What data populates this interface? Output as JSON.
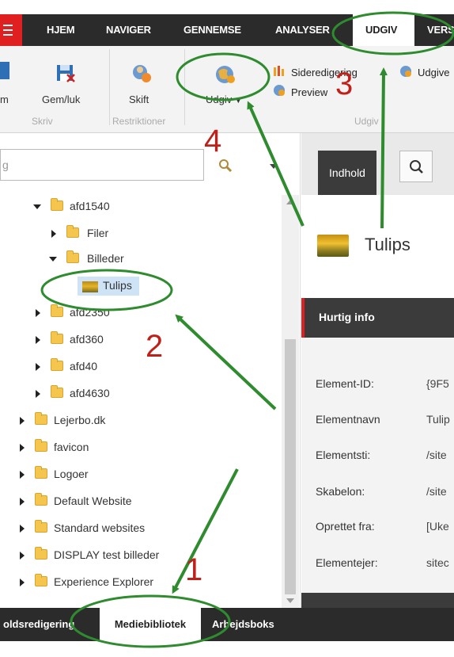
{
  "top_nav": {
    "tabs": [
      {
        "label": "HJEM"
      },
      {
        "label": "NAVIGER"
      },
      {
        "label": "GENNEMSE"
      },
      {
        "label": "ANALYSER"
      },
      {
        "label": "UDGIV"
      },
      {
        "label": "VERS"
      }
    ],
    "active_tab": "UDGIV"
  },
  "ribbon": {
    "buttons": {
      "save_partial": "m",
      "save_close": "Gem/luk",
      "shift": "Skift",
      "publish": "Udgiv",
      "page_edit": "Sideredigering",
      "preview": "Preview",
      "publish_partial": "Udgive"
    },
    "groups": {
      "write": "Skriv",
      "restrictions": "Restriktioner",
      "publish_group": "Udgiv"
    }
  },
  "search": {
    "value": "g"
  },
  "tree": [
    {
      "label": "afd1540",
      "expanded": true
    },
    {
      "label": "Filer",
      "expanded": false
    },
    {
      "label": "Billeder",
      "expanded": true
    },
    {
      "label": "Tulips",
      "selected": true
    },
    {
      "label": "afd2350",
      "expanded": false
    },
    {
      "label": "afd360",
      "expanded": false
    },
    {
      "label": "afd40",
      "expanded": false
    },
    {
      "label": "afd4630",
      "expanded": false
    },
    {
      "label": "Lejerbo.dk",
      "expanded": false
    },
    {
      "label": "favicon",
      "expanded": false
    },
    {
      "label": "Logoer",
      "expanded": false
    },
    {
      "label": "Default Website",
      "expanded": false
    },
    {
      "label": "Standard websites",
      "expanded": false
    },
    {
      "label": "DISPLAY test billeder",
      "expanded": false
    },
    {
      "label": "Experience Explorer",
      "expanded": false
    }
  ],
  "bottom_tabs": [
    {
      "label": "oldsredigering"
    },
    {
      "label": "Mediebibliotek"
    },
    {
      "label": "Arbejdsboks"
    }
  ],
  "right_panel": {
    "tab_content": "Indhold",
    "item_title": "Tulips",
    "quick_info_header": "Hurtig info",
    "quick_info": [
      {
        "label": "Element-ID:",
        "value": "{9F5"
      },
      {
        "label": "Elementnavn",
        "value": "Tulip"
      },
      {
        "label": "Elementsti:",
        "value": "/site"
      },
      {
        "label": "Skabelon:",
        "value": "/site"
      },
      {
        "label": "Oprettet fra:",
        "value": "[Uke"
      },
      {
        "label": "Elementejer:",
        "value": "sitec"
      }
    ]
  },
  "annotations": {
    "step1": "1",
    "step2": "2",
    "step3": "3",
    "step4": "4"
  },
  "colors": {
    "annotation_circle": "#2e8b2e",
    "annotation_number": "#c0201a",
    "nav_dark": "#2b2b2b",
    "accent_red": "#e02020"
  }
}
